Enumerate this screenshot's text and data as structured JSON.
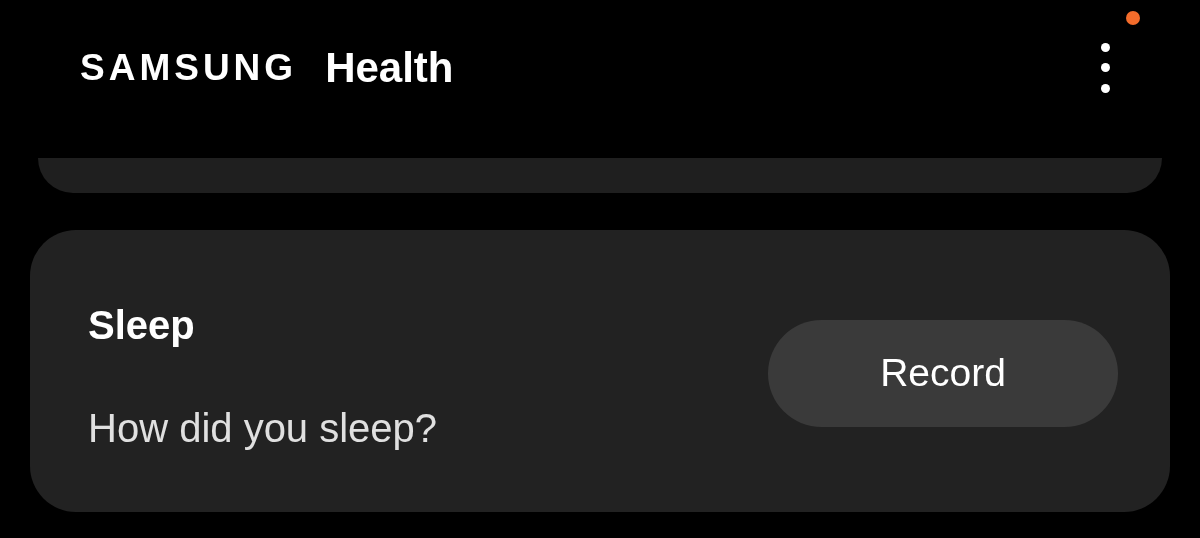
{
  "header": {
    "brand": "SAMSUNG",
    "app_name": "Health",
    "menu_notification": true
  },
  "cards": [
    {
      "kind": "collapsed"
    },
    {
      "kind": "action",
      "title": "Sleep",
      "prompt": "How did you sleep?",
      "button": "Record"
    }
  ]
}
